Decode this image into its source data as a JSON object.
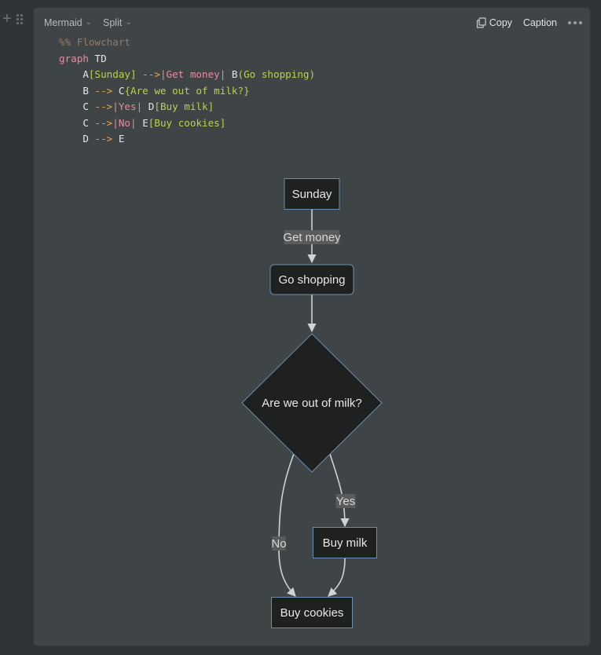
{
  "block_controls": {
    "add_icon": "plus-icon",
    "drag_icon": "drag-handle-icon"
  },
  "toolbar": {
    "language": "Mermaid",
    "view_mode": "Split",
    "copy_label": "Copy",
    "caption_label": "Caption",
    "more_icon": "more-horizontal-icon"
  },
  "code": {
    "lines": [
      [
        {
          "t": "%% Flowchart",
          "c": "com"
        }
      ],
      [
        {
          "t": "graph",
          "c": "kw"
        },
        {
          "t": " TD",
          "c": "id"
        }
      ],
      [
        {
          "t": "    A",
          "c": "id"
        },
        {
          "t": "[Sunday]",
          "c": "str"
        },
        {
          "t": " -->",
          "c": "op"
        },
        {
          "t": "|Get money|",
          "c": "lbl"
        },
        {
          "t": " B",
          "c": "id"
        },
        {
          "t": "(Go shopping)",
          "c": "str"
        }
      ],
      [
        {
          "t": "    B",
          "c": "id"
        },
        {
          "t": " -->",
          "c": "op"
        },
        {
          "t": " C",
          "c": "id"
        },
        {
          "t": "{Are we out of milk?}",
          "c": "str"
        }
      ],
      [
        {
          "t": "    C",
          "c": "id"
        },
        {
          "t": " -->",
          "c": "op"
        },
        {
          "t": "|Yes|",
          "c": "lbl"
        },
        {
          "t": " D",
          "c": "id"
        },
        {
          "t": "[Buy milk]",
          "c": "str"
        }
      ],
      [
        {
          "t": "    C",
          "c": "id"
        },
        {
          "t": " -->",
          "c": "op"
        },
        {
          "t": "|No|",
          "c": "lbl"
        },
        {
          "t": " E",
          "c": "id"
        },
        {
          "t": "[Buy cookies]",
          "c": "str"
        }
      ],
      [
        {
          "t": "    D",
          "c": "id"
        },
        {
          "t": " -->",
          "c": "op"
        },
        {
          "t": " E",
          "c": "id"
        }
      ]
    ]
  },
  "diagram": {
    "nodes": {
      "A": {
        "label": "Sunday",
        "shape": "rect"
      },
      "B": {
        "label": "Go shopping",
        "shape": "round"
      },
      "C": {
        "label": "Are we out of milk?",
        "shape": "diamond"
      },
      "D": {
        "label": "Buy milk",
        "shape": "rect"
      },
      "E": {
        "label": "Buy cookies",
        "shape": "rect"
      }
    },
    "edges": [
      {
        "from": "A",
        "to": "B",
        "label": "Get money"
      },
      {
        "from": "B",
        "to": "C",
        "label": ""
      },
      {
        "from": "C",
        "to": "D",
        "label": "Yes"
      },
      {
        "from": "C",
        "to": "E",
        "label": "No"
      },
      {
        "from": "D",
        "to": "E",
        "label": ""
      }
    ],
    "colors": {
      "node_fill": "#1f2020",
      "node_stroke": "#6a8fb0",
      "edge": "#d0d2d3",
      "edge_label_bg": "#5a5c5c"
    }
  }
}
